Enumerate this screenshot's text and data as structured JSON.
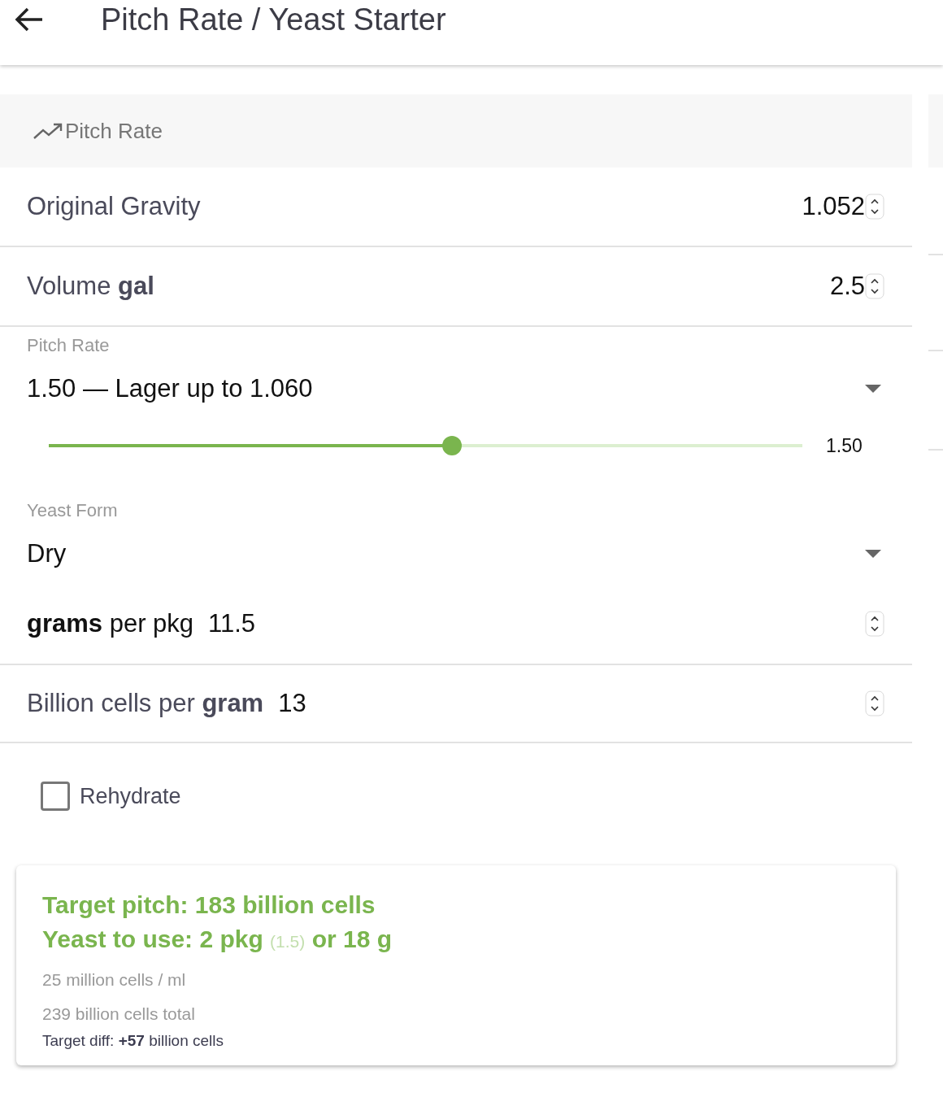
{
  "header": {
    "title": "Pitch Rate / Yeast Starter"
  },
  "section": {
    "title": "Pitch Rate"
  },
  "fields": [
    {
      "label": "Original Gravity",
      "value": "1.052"
    },
    {
      "label": "Volume **gal**",
      "value": "2.5"
    }
  ],
  "pitch_rate": {
    "label": "Pitch Rate",
    "value": "1.50 — Lager up to 1.060",
    "slider": {
      "level": 0.535,
      "reading": "1.50"
    }
  },
  "yeast_form": {
    "label": "Yeast Form",
    "value": "Dry"
  },
  "package_field": {
    "label": "**grams** per pkg",
    "value": "11.5"
  },
  "cells_field": {
    "label": "Billion cells per **gram**",
    "value": "13"
  },
  "rehydrate": {
    "label": "Rehydrate",
    "checked": false
  },
  "result": {
    "target": "Target pitch: 183 billion cells",
    "yeast": {
      "text": "Yeast to use: 2 pkg",
      "note": "(1.5)",
      "rest": "or 18 g"
    },
    "density": "25 million cells / ml",
    "total": "239 billion cells total",
    "diff": "Target diff: **+57** billion cells"
  }
}
